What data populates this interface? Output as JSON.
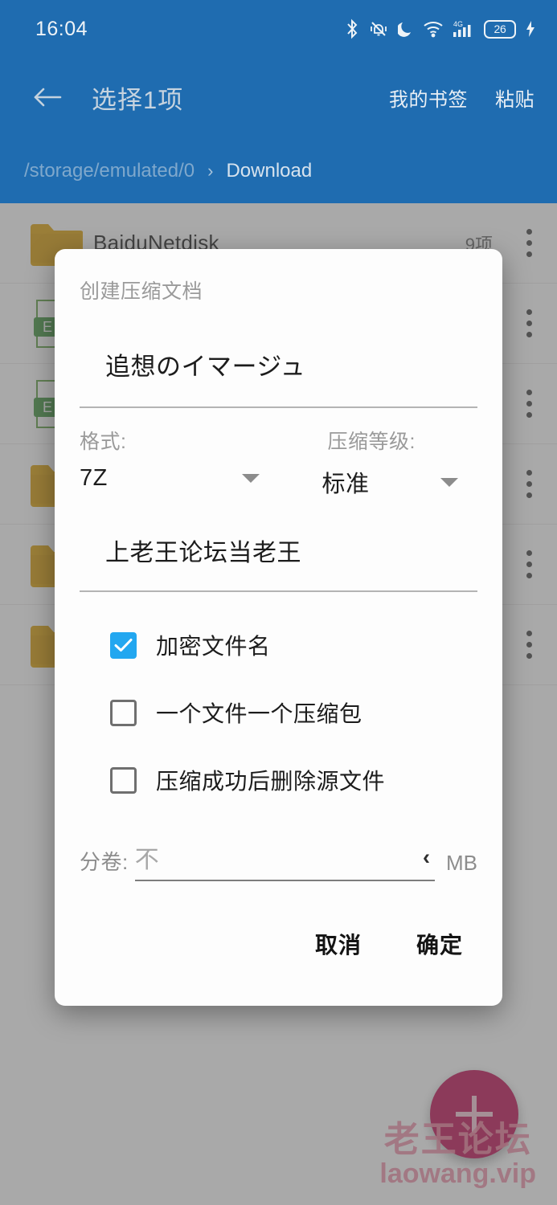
{
  "status_bar": {
    "clock": "16:04",
    "battery_level": "26",
    "icons": [
      "bluetooth-icon",
      "vibrate-bell-icon",
      "dnd-moon-icon",
      "wifi-icon",
      "signal-4g-icon",
      "battery-icon",
      "charging-bolt-icon"
    ]
  },
  "app_bar": {
    "back_label": "back-arrow",
    "title": "选择1项",
    "action_bookmarks": "我的书签",
    "action_paste": "粘贴",
    "background_color": "#1f6cb0"
  },
  "breadcrumb": {
    "root": "/storage/emulated/0",
    "separator": "›",
    "current": "Download"
  },
  "file_list": {
    "rows": [
      {
        "name": "BaiduNetdisk",
        "meta": "9项",
        "icon": "folder-icon"
      },
      {
        "name": "",
        "meta": "",
        "icon": "excel-file-icon"
      },
      {
        "name": "",
        "meta": "",
        "icon": "excel-file-icon"
      },
      {
        "name": "",
        "meta": "",
        "icon": "folder-icon"
      },
      {
        "name": "",
        "meta": "",
        "icon": "folder-icon"
      },
      {
        "name": "",
        "meta": "",
        "icon": "folder-icon"
      }
    ]
  },
  "fab": {
    "icon": "plus-icon",
    "color": "#c2185b"
  },
  "watermark": {
    "line1": "老王论坛",
    "line2": "laowang.vip",
    "color": "#f08ba6"
  },
  "dialog": {
    "title": "创建压缩文档",
    "archive_name": {
      "value": "追想のイマージュ",
      "placeholder": ""
    },
    "format": {
      "label": "格式:",
      "value": "7Z"
    },
    "level": {
      "label": "压缩等级:",
      "value": "标准"
    },
    "password": {
      "value": "上老王论坛当老王",
      "placeholder": ""
    },
    "checkboxes": [
      {
        "label": "加密文件名",
        "checked": true
      },
      {
        "label": "一个文件一个压缩包",
        "checked": false
      },
      {
        "label": "压缩成功后删除源文件",
        "checked": false
      }
    ],
    "split": {
      "label": "分卷:",
      "value": "不",
      "unit": "MB",
      "chevron": "‹"
    },
    "cancel_label": "取消",
    "confirm_label": "确定",
    "accent_color": "#22a7f0"
  }
}
